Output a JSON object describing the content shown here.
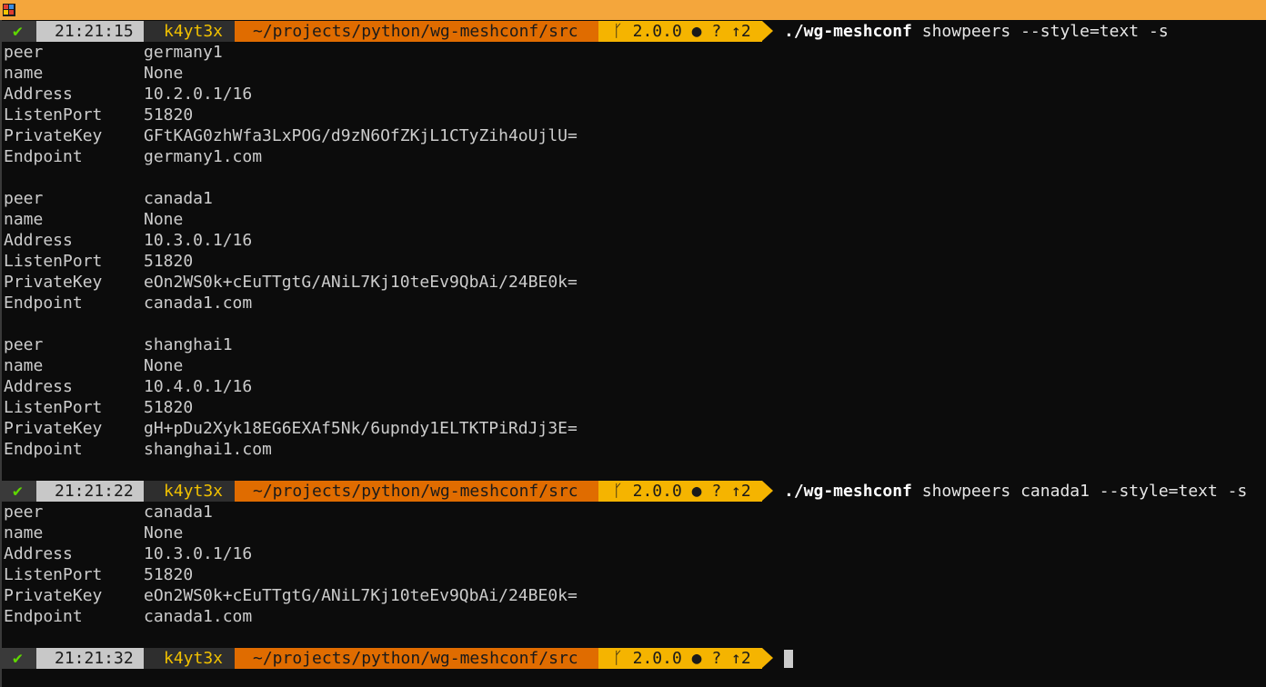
{
  "colors": {
    "titlebar": "#f4a63c",
    "terminal_bg": "#0c0c0c",
    "text": "#cccccc",
    "status_bg": "#3a3a3a",
    "check": "#5fd700",
    "time_bg": "#c8c8c8",
    "user_bg": "#2e2e2e",
    "user_fg": "#f0c000",
    "path_bg": "#e06c00",
    "git_bg": "#f5b400"
  },
  "prompts": [
    {
      "check": "✔",
      "time": "21:21:15",
      "user": "k4yt3x",
      "path": "~/projects/python/wg-meshconf/src",
      "git": "ᚴ 2.0.0 ● ? ↑2",
      "exe": "./wg-meshconf",
      "args": " showpeers --style=text -s"
    },
    {
      "check": "✔",
      "time": "21:21:22",
      "user": "k4yt3x",
      "path": "~/projects/python/wg-meshconf/src",
      "git": "ᚴ 2.0.0 ● ? ↑2",
      "exe": "./wg-meshconf",
      "args": " showpeers canada1 --style=text -s"
    },
    {
      "check": "✔",
      "time": "21:21:32",
      "user": "k4yt3x",
      "path": "~/projects/python/wg-meshconf/src",
      "git": "ᚴ 2.0.0 ● ? ↑2",
      "exe": "",
      "args": ""
    }
  ],
  "output1": [
    {
      "key": "peer",
      "val": "germany1"
    },
    {
      "key": "name",
      "val": "None"
    },
    {
      "key": "Address",
      "val": "10.2.0.1/16"
    },
    {
      "key": "ListenPort",
      "val": "51820"
    },
    {
      "key": "PrivateKey",
      "val": "GFtKAG0zhWfa3LxPOG/d9zN6OfZKjL1CTyZih4oUjlU="
    },
    {
      "key": "Endpoint",
      "val": "germany1.com"
    },
    {
      "key": "peer",
      "val": "canada1"
    },
    {
      "key": "name",
      "val": "None"
    },
    {
      "key": "Address",
      "val": "10.3.0.1/16"
    },
    {
      "key": "ListenPort",
      "val": "51820"
    },
    {
      "key": "PrivateKey",
      "val": "eOn2WS0k+cEuTTgtG/ANiL7Kj10teEv9QbAi/24BE0k="
    },
    {
      "key": "Endpoint",
      "val": "canada1.com"
    },
    {
      "key": "peer",
      "val": "shanghai1"
    },
    {
      "key": "name",
      "val": "None"
    },
    {
      "key": "Address",
      "val": "10.4.0.1/16"
    },
    {
      "key": "ListenPort",
      "val": "51820"
    },
    {
      "key": "PrivateKey",
      "val": "gH+pDu2Xyk18EG6EXAf5Nk/6upndy1ELTKTPiRdJj3E="
    },
    {
      "key": "Endpoint",
      "val": "shanghai1.com"
    }
  ],
  "output2": [
    {
      "key": "peer",
      "val": "canada1"
    },
    {
      "key": "name",
      "val": "None"
    },
    {
      "key": "Address",
      "val": "10.3.0.1/16"
    },
    {
      "key": "ListenPort",
      "val": "51820"
    },
    {
      "key": "PrivateKey",
      "val": "eOn2WS0k+cEuTTgtG/ANiL7Kj10teEv9QbAi/24BE0k="
    },
    {
      "key": "Endpoint",
      "val": "canada1.com"
    }
  ]
}
